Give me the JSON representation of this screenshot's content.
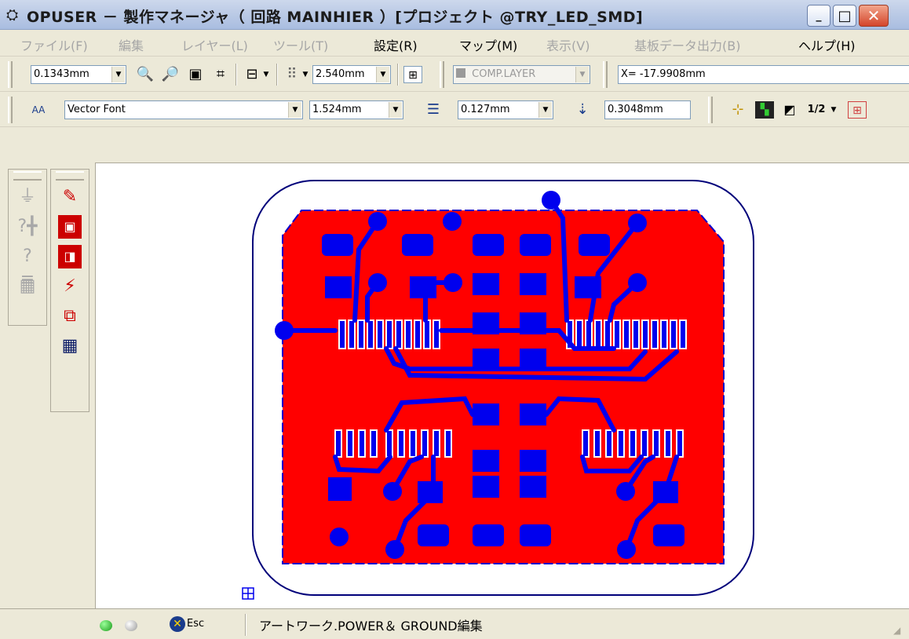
{
  "window": {
    "title": "OPUSER － 製作マネージャ（ 回路 MAINHIER ）[プロジェクト @TRY_LED_SMD]",
    "app_icon": "pcb-app-icon",
    "buttons": {
      "minimize": "_",
      "maximize": "□",
      "close": "✕"
    }
  },
  "menu": [
    {
      "label": "ファイル(F)",
      "enabled": false
    },
    {
      "label": "編集",
      "enabled": false
    },
    {
      "label": "レイヤー(L)",
      "enabled": false
    },
    {
      "label": "ツール(T)",
      "enabled": false
    },
    {
      "label": "設定(R)",
      "enabled": true
    },
    {
      "label": "マップ(M)",
      "enabled": true
    },
    {
      "label": "表示(V)",
      "enabled": false
    },
    {
      "label": "基板データ出力(B)",
      "enabled": false
    },
    {
      "label": "ヘルプ(H)",
      "enabled": true
    }
  ],
  "toolbar1": {
    "zoom_value": "0.1343mm",
    "grid_value": "2.540mm",
    "layer": "COMP.LAYER",
    "coord_readout": "X= -17.9908mm"
  },
  "toolbar2": {
    "font_icon_text": "AA",
    "font": "Vector Font",
    "text_size": "1.524mm",
    "line_width": "0.127mm",
    "clearance": "0.3048mm",
    "half_label": "1/2"
  },
  "statusbar": {
    "esc_label": "Esc",
    "message": "アートワーク.POWER＆ GROUND編集"
  },
  "colors": {
    "copper": "#ff0000",
    "pad": "#0000ee",
    "outline": "#00007a",
    "title_bar": "#bccbe6"
  }
}
